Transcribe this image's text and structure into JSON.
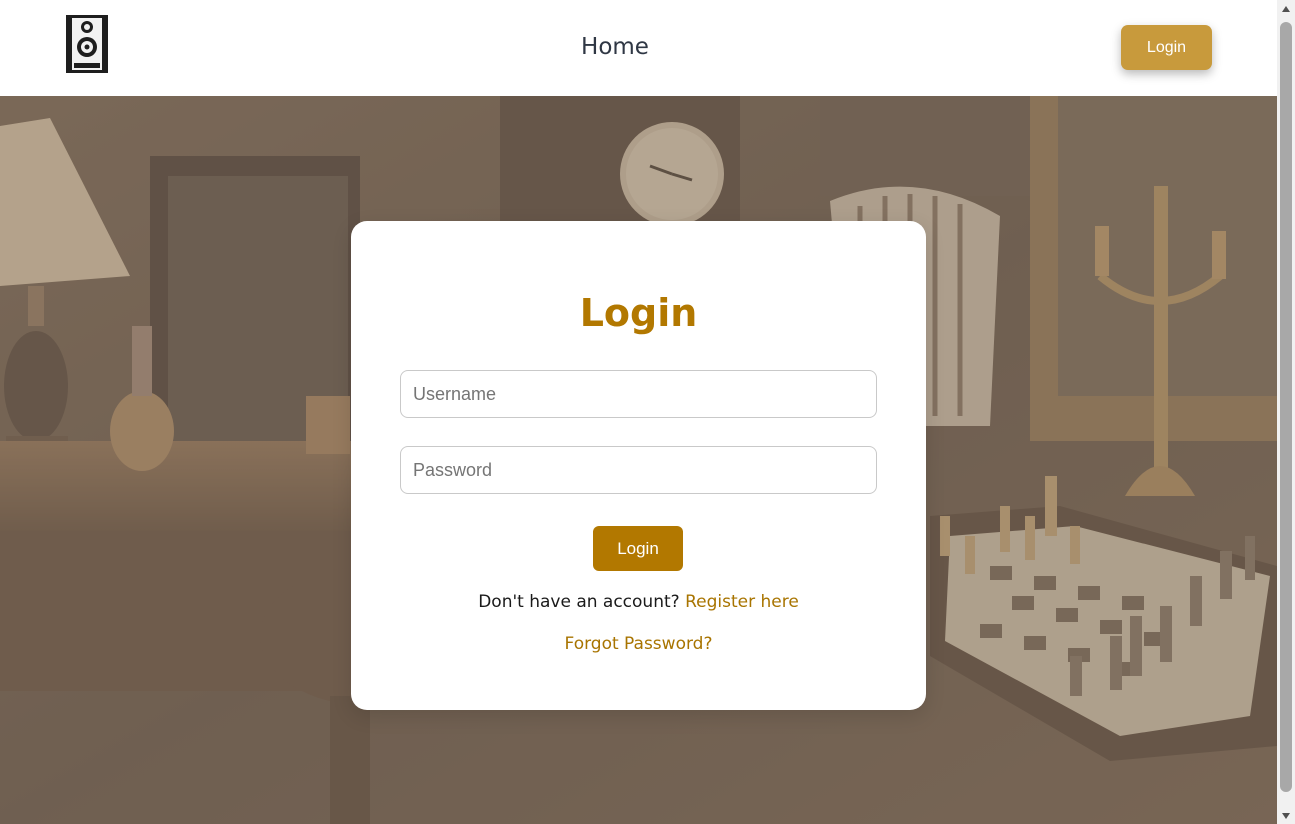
{
  "header": {
    "logo_icon": "speaker-logo-icon",
    "nav_home": "Home",
    "login_button": "Login",
    "accent": "#c89a3c"
  },
  "login_card": {
    "title": "Login",
    "username_placeholder": "Username",
    "password_placeholder": "Password",
    "submit_label": "Login",
    "register_prompt": "Don't have an account?",
    "register_link": "Register here",
    "forgot_link": "Forgot Password?",
    "accent": "#b27800"
  },
  "scrollbar": {
    "up_icon": "scroll-up-arrow-icon",
    "down_icon": "scroll-down-arrow-icon"
  }
}
